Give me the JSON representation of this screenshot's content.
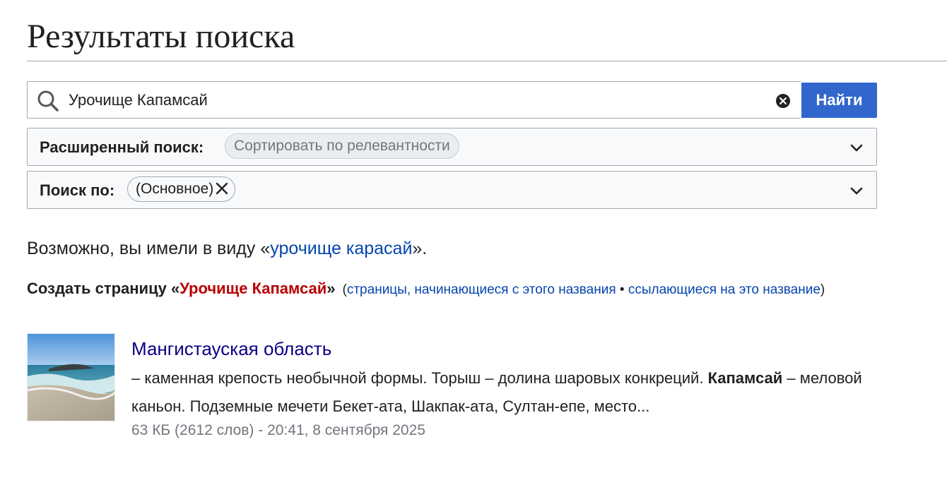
{
  "page": {
    "title": "Результаты поиска"
  },
  "search": {
    "value": "Урочище Капамсай",
    "button_label": "Найти",
    "icon": "search-icon",
    "clear_icon": "clear-icon"
  },
  "advanced": {
    "label": "Расширенный поиск:",
    "chip": "Сортировать по релевантности"
  },
  "namespace": {
    "label": "Поиск по:",
    "chip": "(Основное)"
  },
  "suggestion": {
    "prefix": "Возможно, вы имели в виду «",
    "link": "урочище карасай",
    "suffix": "»."
  },
  "create": {
    "prefix": "Создать страницу «",
    "link": "Урочище Капамсай",
    "suffix": "»",
    "meta_open": "(",
    "link_prefix": "страницы, начинающиеся с этого названия",
    "separator": " • ",
    "link_links": "ссылающиеся на это название",
    "meta_close": ")"
  },
  "results": [
    {
      "title": "Мангистауская область",
      "snippet_before": "– каменная крепость необычной формы. Торыш – долина шаровых конкреций. ",
      "snippet_match": "Капамсай",
      "snippet_after": " – меловой каньон. Подземные мечети Бекет-ата, Шакпак-ата, Султан-епе, место...",
      "meta": "63 КБ (2612 слов) - 20:41, 8 сентября 2025"
    }
  ],
  "colors": {
    "accent": "#3366cc",
    "link": "#0645ad",
    "redlink": "#ba0000",
    "visited_title": "#0b0080"
  }
}
